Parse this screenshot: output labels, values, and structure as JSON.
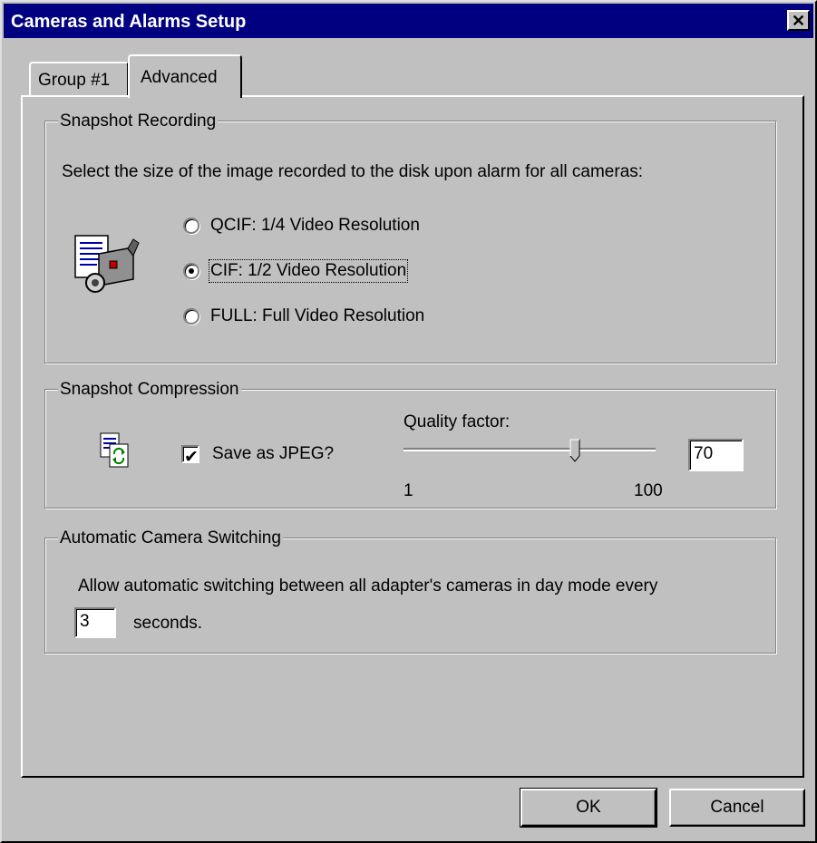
{
  "window": {
    "title": "Cameras and Alarms Setup",
    "close_glyph": "✕"
  },
  "tabs": [
    {
      "label": "Group #1",
      "selected": false
    },
    {
      "label": "Advanced",
      "selected": true
    }
  ],
  "snapshot_recording": {
    "legend": "Snapshot Recording",
    "description": "Select the size of the image recorded to the disk upon alarm for all cameras:",
    "icon": "video-camera-icon",
    "options": [
      {
        "label": "QCIF: 1/4 Video Resolution",
        "checked": false
      },
      {
        "label": "CIF: 1/2 Video Resolution",
        "checked": true
      },
      {
        "label": "FULL: Full Video Resolution",
        "checked": false
      }
    ]
  },
  "snapshot_compression": {
    "legend": "Snapshot Compression",
    "icon": "file-convert-icon",
    "save_jpeg_label": "Save as JPEG?",
    "save_jpeg_checked": true,
    "check_glyph": "✔",
    "quality_label": "Quality factor:",
    "slider_min": "1",
    "slider_max": "100",
    "quality_value": "70"
  },
  "camera_switching": {
    "legend": "Automatic Camera Switching",
    "description": "Allow automatic switching between all adapter's cameras in day mode every",
    "interval_value": "3",
    "unit_label": "seconds."
  },
  "buttons": {
    "ok": "OK",
    "cancel": "Cancel"
  }
}
